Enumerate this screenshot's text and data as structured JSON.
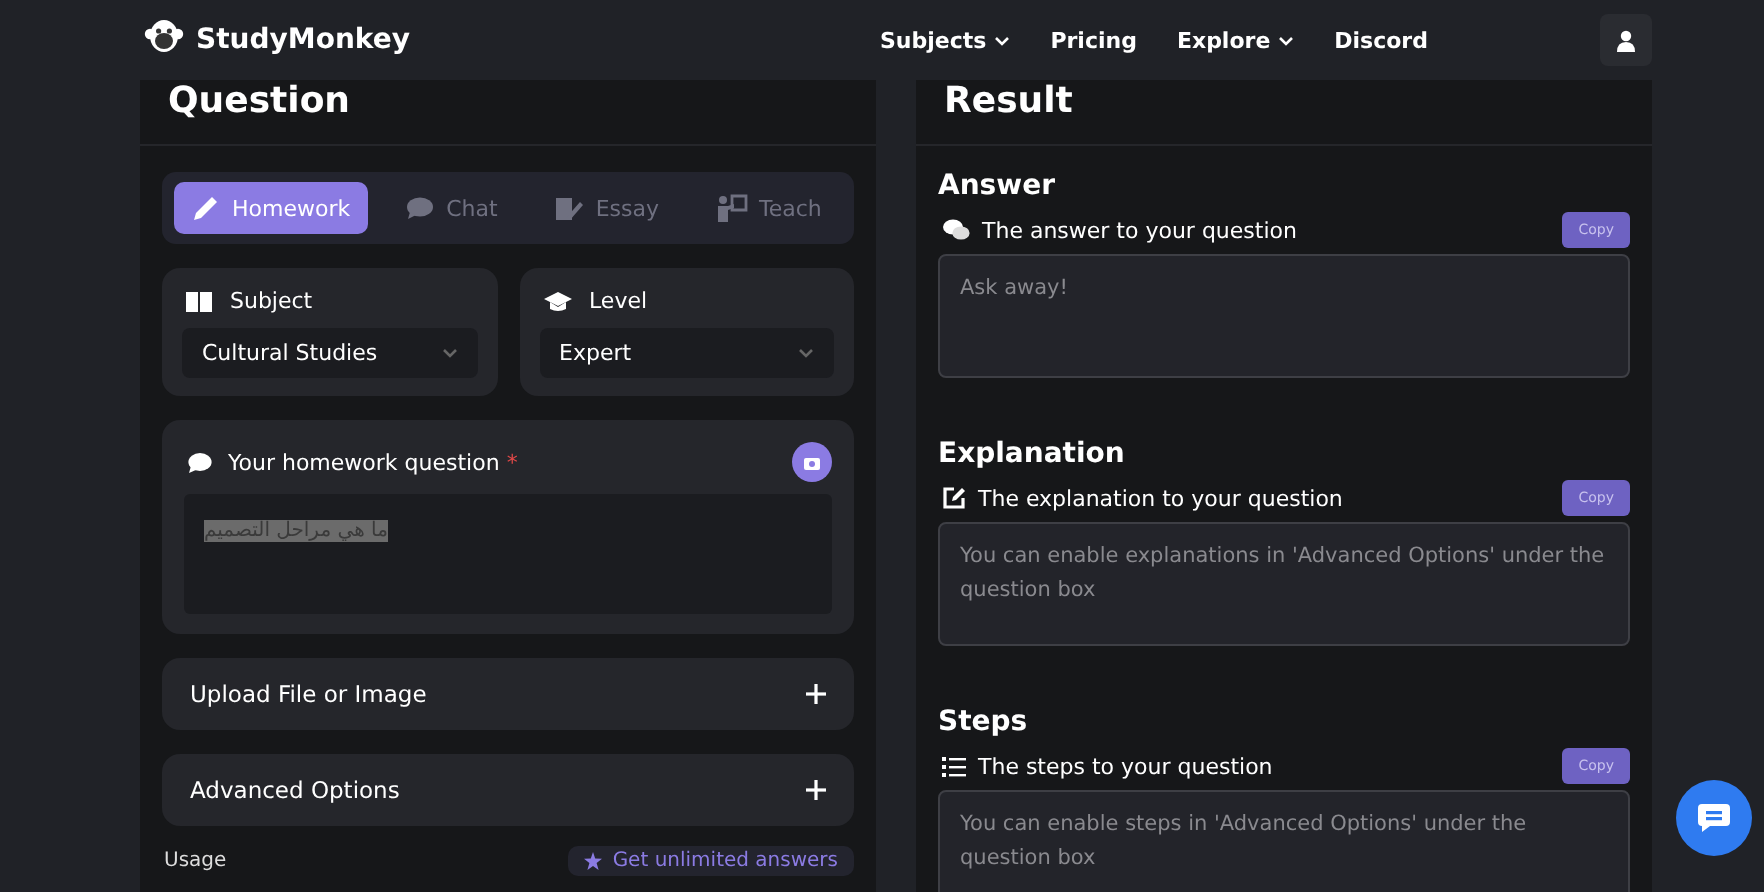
{
  "header": {
    "brand": "StudyMonkey",
    "nav": [
      {
        "label": "Subjects",
        "dropdown": true
      },
      {
        "label": "Pricing",
        "dropdown": false
      },
      {
        "label": "Explore",
        "dropdown": true
      },
      {
        "label": "Discord",
        "dropdown": false
      }
    ]
  },
  "question": {
    "title": "Question",
    "tabs": [
      {
        "label": "Homework",
        "selected": true
      },
      {
        "label": "Chat",
        "selected": false
      },
      {
        "label": "Essay",
        "selected": false
      },
      {
        "label": "Teach",
        "selected": false
      }
    ],
    "selects": [
      {
        "label": "Subject",
        "value": "Cultural Studies"
      },
      {
        "label": "Level",
        "value": "Expert"
      }
    ],
    "input": {
      "label": "Your homework question",
      "required_mark": "*",
      "value": "ما هي مراحل التصميم",
      "highlighted": true
    },
    "sections": [
      {
        "label": "Upload File or Image",
        "expanded": false
      },
      {
        "label": "Advanced Options",
        "expanded": false
      }
    ],
    "usage": {
      "label": "Usage",
      "button": "Get unlimited answers"
    }
  },
  "result": {
    "title": "Result",
    "blocks": [
      {
        "heading": "Answer",
        "label": "The answer to your question",
        "copy": "Copy",
        "placeholder": "Ask away!"
      },
      {
        "heading": "Explanation",
        "label": "The explanation to your question",
        "copy": "Copy",
        "placeholder": "You can enable explanations in 'Advanced Options' under the question box"
      },
      {
        "heading": "Steps",
        "label": "The steps to your question",
        "copy": "Copy",
        "placeholder": "You can enable steps in 'Advanced Options' under the question box"
      }
    ]
  }
}
